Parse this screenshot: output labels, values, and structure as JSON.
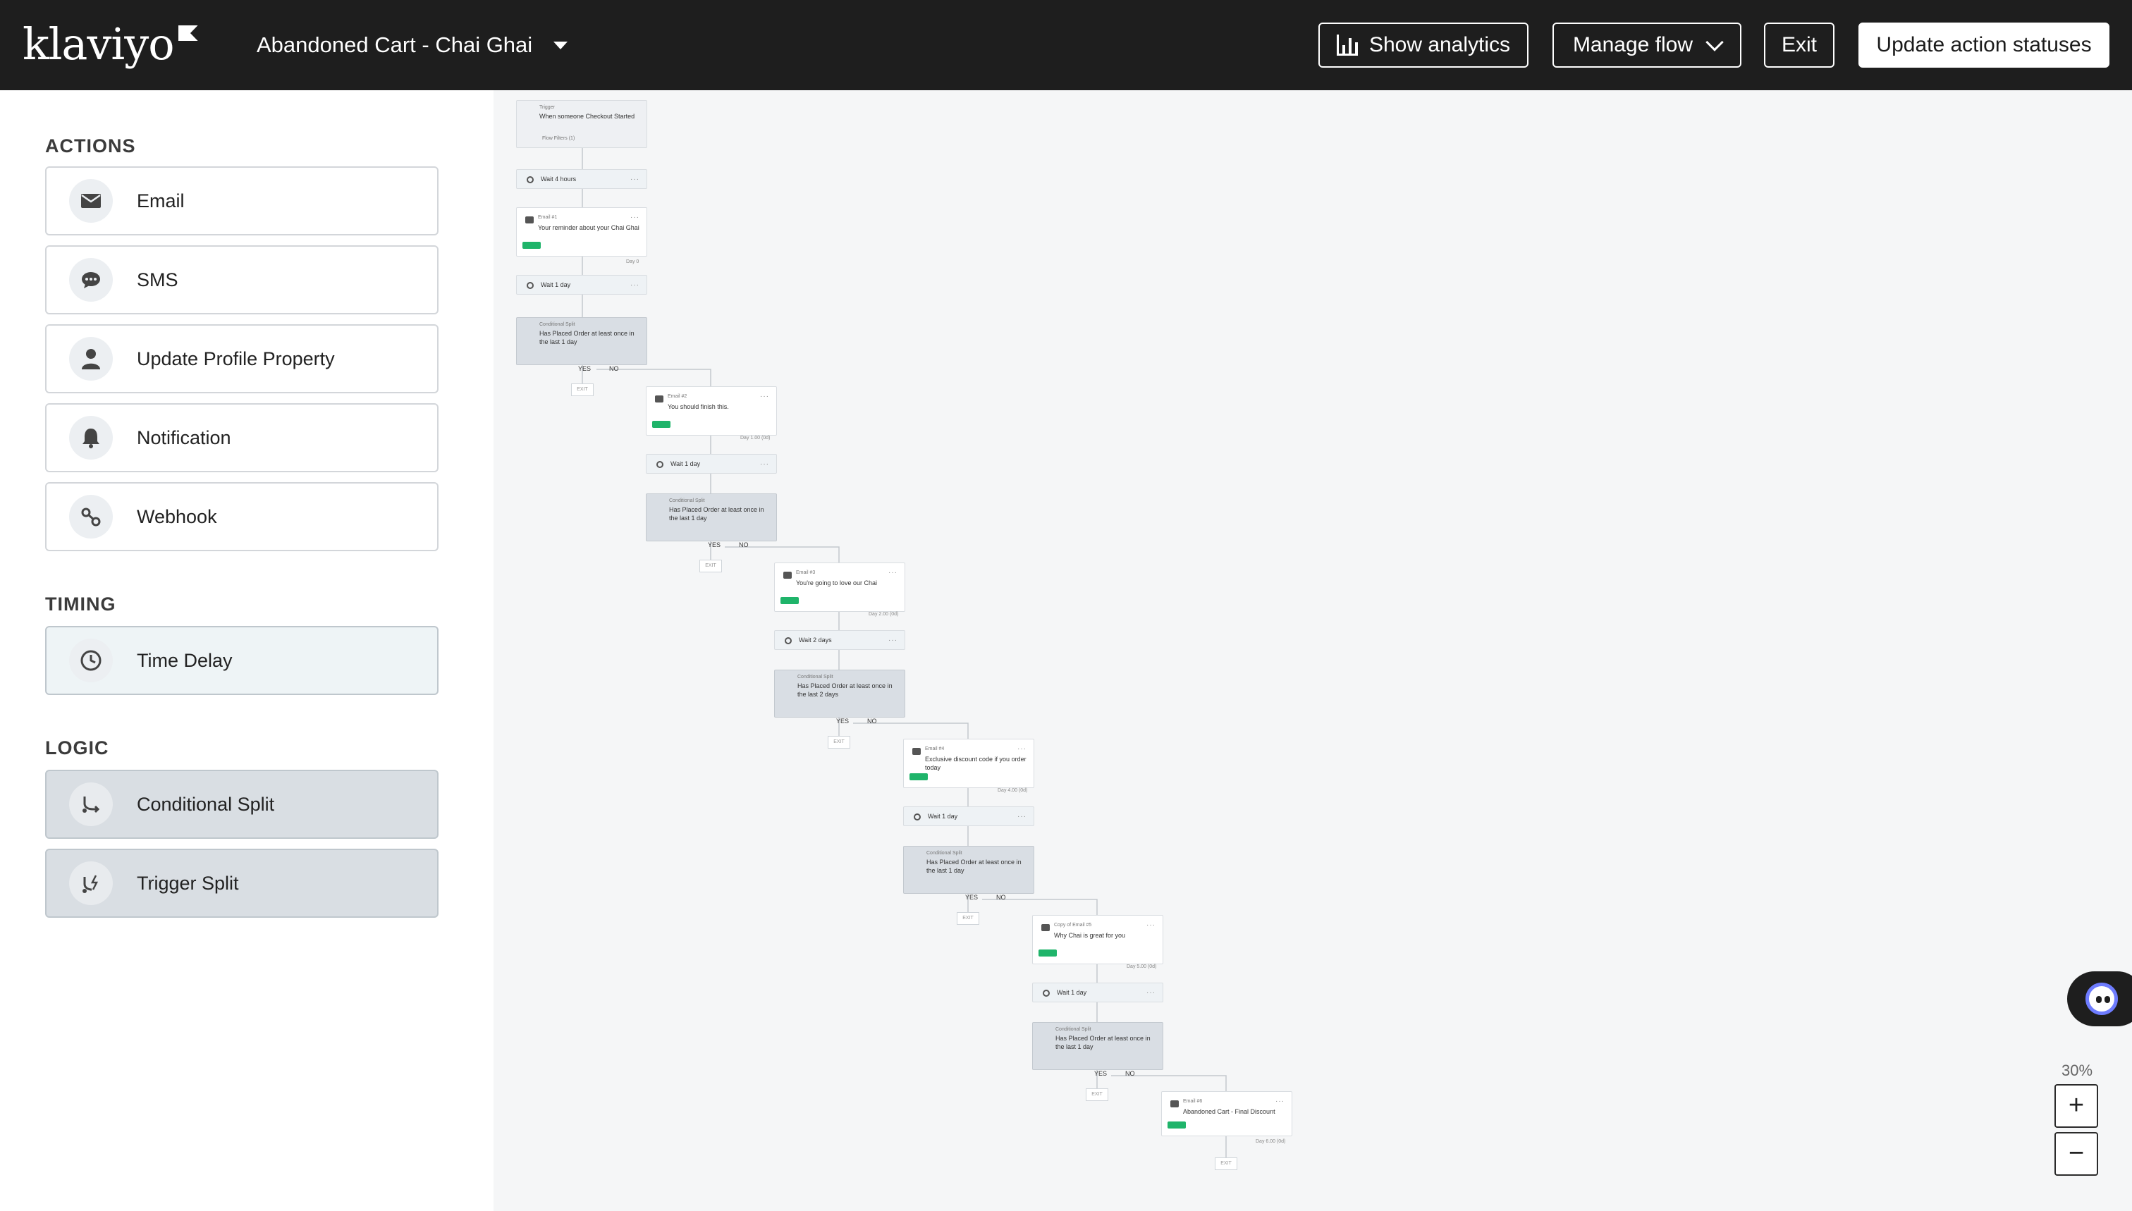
{
  "header": {
    "logo": "klaviyo",
    "flow_title": "Abandoned Cart - Chai Ghai",
    "buttons": {
      "analytics": "Show analytics",
      "manage": "Manage flow",
      "exit": "Exit",
      "update": "Update action statuses"
    }
  },
  "sidebar": {
    "actions_title": "ACTIONS",
    "actions": [
      {
        "label": "Email",
        "icon": "envelope-icon"
      },
      {
        "label": "SMS",
        "icon": "chat-icon"
      },
      {
        "label": "Update Profile Property",
        "icon": "person-icon"
      },
      {
        "label": "Notification",
        "icon": "bell-icon"
      },
      {
        "label": "Webhook",
        "icon": "webhook-icon"
      }
    ],
    "timing_title": "TIMING",
    "timing": [
      {
        "label": "Time Delay",
        "icon": "clock-icon"
      }
    ],
    "logic_title": "LOGIC",
    "logic": [
      {
        "label": "Conditional Split",
        "icon": "split-icon"
      },
      {
        "label": "Trigger Split",
        "icon": "trigger-split-icon"
      }
    ]
  },
  "canvas": {
    "trigger": {
      "tag": "Trigger",
      "text": "When someone Checkout Started",
      "filters": "Flow Filters (1)"
    },
    "wait_first": "Wait 4 hours",
    "emails": [
      {
        "tag": "Email #1",
        "text": "Your reminder about your Chai Ghai",
        "day": "Day 0"
      },
      {
        "tag": "Email #2",
        "text": "You should finish this.",
        "day": "Day 1.00 (0d)"
      },
      {
        "tag": "Email #3",
        "text": "You're going to love our Chai",
        "day": "Day 2.00 (0d)"
      },
      {
        "tag": "Email #4",
        "text": "Exclusive discount code if you order today",
        "day": "Day 4.00 (0d)"
      },
      {
        "tag": "Copy of Email #5",
        "text": "Why Chai is great for you",
        "day": "Day 5.00 (0d)"
      },
      {
        "tag": "Email #6",
        "text": "Abandoned Cart - Final Discount",
        "day": "Day 6.00 (0d)"
      }
    ],
    "waits": [
      "Wait 1 day",
      "Wait 1 day",
      "Wait 2 days",
      "Wait 1 day",
      "Wait 1 day"
    ],
    "split_tag": "Conditional Split",
    "split_texts": [
      "Has Placed Order at least once in the last 1 day",
      "Has Placed Order at least once in the last 1 day",
      "Has Placed Order at least once in the last 2 days",
      "Has Placed Order at least once in the last 1 day",
      "Has Placed Order at least once in the last 1 day"
    ],
    "yes": "YES",
    "no": "NO",
    "exit": "EXIT"
  },
  "zoom": {
    "label": "30%",
    "plus": "+",
    "minus": "−"
  }
}
